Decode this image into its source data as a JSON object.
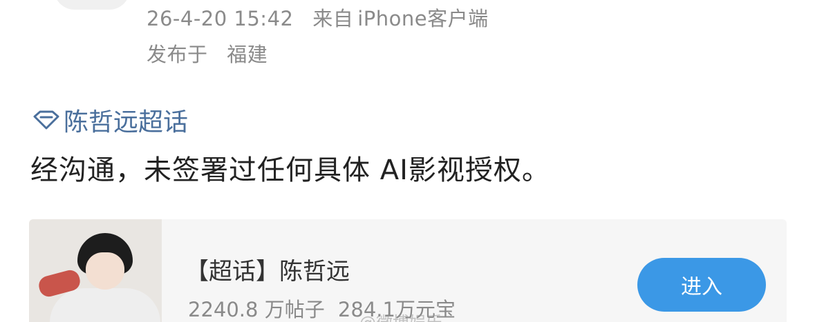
{
  "post_meta": {
    "time": "26-4-20 15:42",
    "source_prefix": "来自",
    "source": "iPhone客户端",
    "location_prefix": "发布于",
    "location": "福建"
  },
  "topic": {
    "icon": "diamond-icon",
    "label": "陈哲远超话",
    "color": "#4a6f9c"
  },
  "post": {
    "text": "经沟通，未签署过任何具体 AI影视授权。"
  },
  "card": {
    "title": "【超话】陈哲远",
    "posts": "2240.8 万帖子",
    "coins": "284.1万元宝",
    "button_label": "进入",
    "button_color": "#3b98e6"
  },
  "watermark": {
    "text": "@微博娱乐"
  }
}
